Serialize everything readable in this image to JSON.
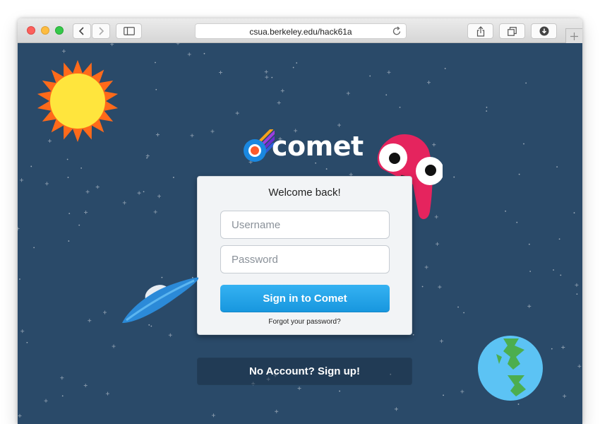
{
  "browser": {
    "url": "csua.berkeley.edu/hack61a",
    "icons": [
      "back-icon",
      "forward-icon",
      "sidebar-icon",
      "reload-icon",
      "share-icon",
      "tabs-icon",
      "download-icon",
      "plus-icon"
    ]
  },
  "brand": {
    "name": "comet"
  },
  "login": {
    "title": "Welcome back!",
    "username_placeholder": "Username",
    "password_placeholder": "Password",
    "signin_label": "Sign in to Comet",
    "forgot_label": "Forgot your password?"
  },
  "signup": {
    "label": "No Account? Sign up!"
  },
  "colors": {
    "background": "#2a4a69",
    "accent": "#1796de",
    "monster": "#e5245e",
    "sun": "#ffe53d",
    "sun_rays": "#ff6a1a"
  }
}
